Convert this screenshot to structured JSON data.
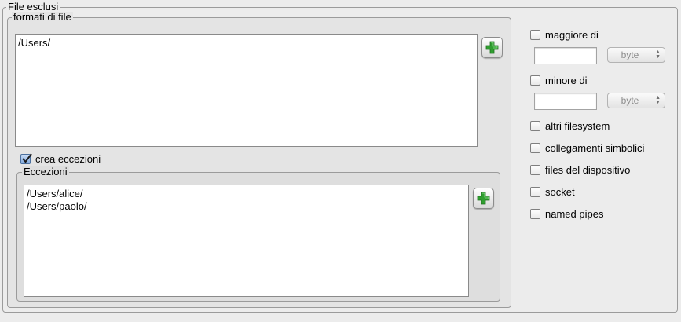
{
  "panel": {
    "title": "File esclusi"
  },
  "formats": {
    "title": "formati di file",
    "items": [
      "/Users/"
    ]
  },
  "create_exceptions": {
    "label": "crea eccezioni",
    "checked": true
  },
  "exceptions": {
    "title": "Eccezioni",
    "items": [
      "/Users/alice/",
      "/Users/paolo/"
    ]
  },
  "size_filters": {
    "greater": {
      "label": "maggiore di",
      "checked": false,
      "value": "",
      "unit": "byte"
    },
    "less": {
      "label": "minore di",
      "checked": false,
      "value": "",
      "unit": "byte"
    }
  },
  "options": [
    {
      "label": "altri filesystem",
      "checked": false
    },
    {
      "label": "collegamenti simbolici",
      "checked": false
    },
    {
      "label": "files del dispositivo",
      "checked": false
    },
    {
      "label": "socket",
      "checked": false
    },
    {
      "label": "named pipes",
      "checked": false
    }
  ],
  "icons": {
    "add": "plus-icon",
    "add_color": "#2f9e2f"
  }
}
